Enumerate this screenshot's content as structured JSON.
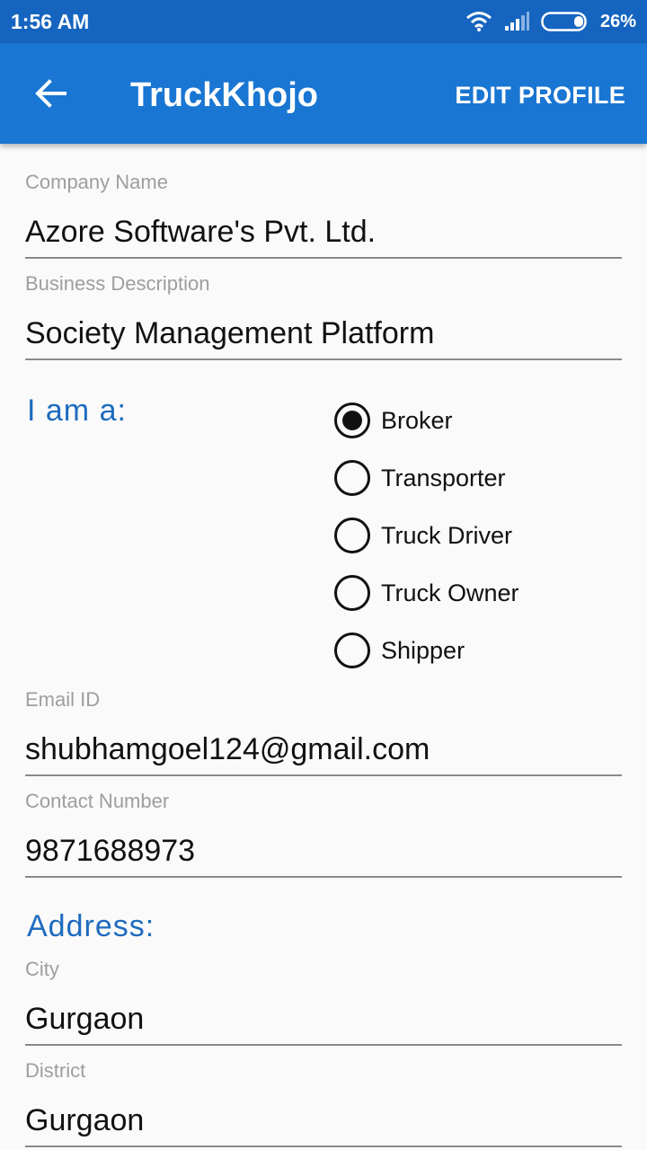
{
  "status_bar": {
    "time": "1:56 AM",
    "battery": "26%"
  },
  "app_bar": {
    "title": "TruckKhojo",
    "action": "EDIT PROFILE"
  },
  "form": {
    "company_name": {
      "label": "Company Name",
      "value": "Azore Software's Pvt. Ltd."
    },
    "business_description": {
      "label": "Business Description",
      "value": "Society Management Platform"
    },
    "role": {
      "label": "I am a:",
      "options": [
        "Broker",
        "Transporter",
        "Truck Driver",
        "Truck Owner",
        "Shipper"
      ],
      "selected": "Broker"
    },
    "email": {
      "label": "Email ID",
      "value": "shubhamgoel124@gmail.com"
    },
    "contact": {
      "label": "Contact Number",
      "value": "9871688973"
    },
    "address": {
      "label": "Address:",
      "city": {
        "label": "City",
        "value": "Gurgaon"
      },
      "district": {
        "label": "District",
        "value": "Gurgaon"
      }
    }
  },
  "icons": {
    "back": "arrow-left-icon",
    "wifi": "wifi-icon",
    "signal": "signal-icon",
    "battery": "battery-icon"
  },
  "colors": {
    "status_bar": "#1565c0",
    "app_bar": "#1976d2",
    "section_title": "#1e6bbf"
  }
}
